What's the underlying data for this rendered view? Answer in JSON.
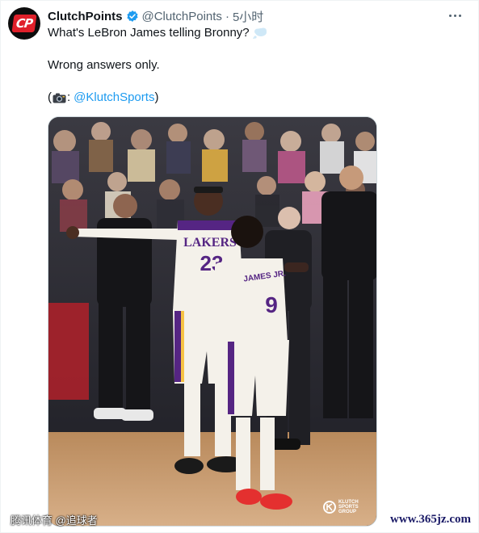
{
  "tweet": {
    "avatar_text": "CP",
    "display_name": "ClutchPoints",
    "handle": "@ClutchPoints",
    "separator": "·",
    "time": "5小时",
    "text_line1": "What's LeBron James telling Bronny?",
    "text_line2": "Wrong answers only.",
    "credit_open": "(",
    "credit_colon": ":",
    "credit_mention": "@KlutchSports",
    "credit_close": ")"
  },
  "photo": {
    "jersey_lebron_team": "LAKERS",
    "jersey_lebron_number": "23",
    "jersey_bronny_name": "JAMES JR.",
    "jersey_bronny_number": "9",
    "brand_logo_text": "KLUTCH SPORTS GROUP"
  },
  "watermarks": {
    "left": "腾讯体育 @追球者",
    "right": "www.365jz.com"
  },
  "colors": {
    "accent": "#1d9bf0",
    "verified": "#1d9bf0",
    "lakers_gold": "#f6c244",
    "lakers_purple": "#552583",
    "shoe_red": "#e4302f"
  },
  "icons": [
    "verified-badge-icon",
    "more-options-icon",
    "thought-balloon-icon",
    "camera-icon",
    "klutch-logo-icon"
  ]
}
